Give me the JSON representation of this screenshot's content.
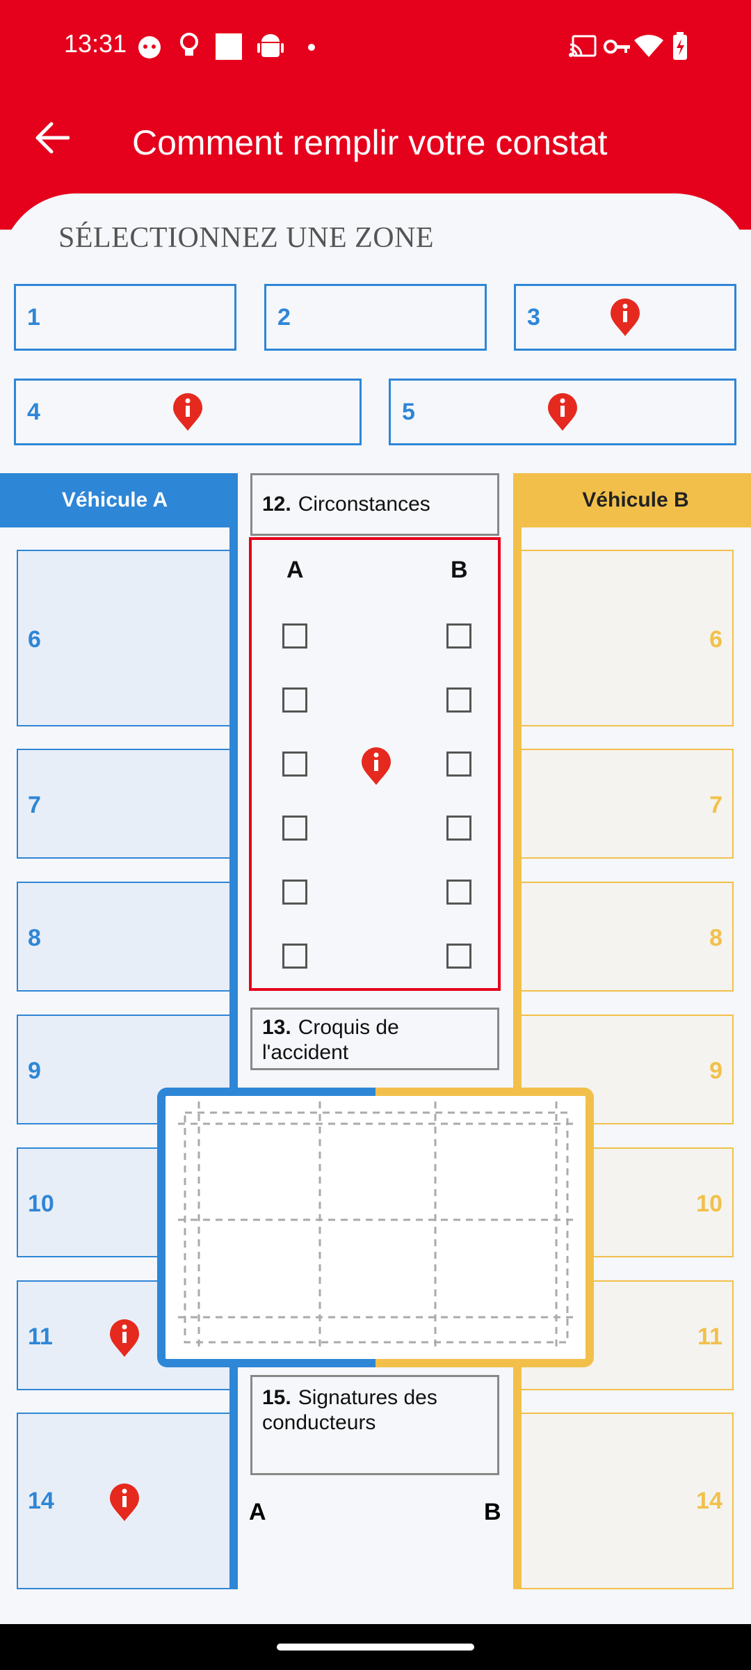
{
  "status_bar": {
    "time": "13:31"
  },
  "header": {
    "title": "Comment remplir votre constat"
  },
  "zone_section": {
    "heading": "SÉLECTIONNEZ UNE ZONE"
  },
  "zones": [
    {
      "label": "1"
    },
    {
      "label": "2"
    },
    {
      "label": "3"
    },
    {
      "label": "4"
    },
    {
      "label": "5"
    }
  ],
  "vehicle_a": {
    "title": "Véhicule A",
    "boxes": [
      "6",
      "7",
      "8",
      "9",
      "10",
      "11",
      "14"
    ]
  },
  "vehicle_b": {
    "title": "Véhicule B",
    "boxes": [
      "6",
      "7",
      "8",
      "9",
      "10",
      "11",
      "14"
    ]
  },
  "circumstances": {
    "number": "12.",
    "title": "Circonstances",
    "col_a": "A",
    "col_b": "B"
  },
  "sketch": {
    "number": "13.",
    "title": "Croquis de l'accident"
  },
  "signatures": {
    "number": "15.",
    "title": "Signatures des conducteurs",
    "a": "A",
    "b": "B"
  },
  "colors": {
    "header": "#e5001c",
    "vehicle_a": "#2e86d6",
    "vehicle_b": "#f2c04a",
    "pin": "#e5291e"
  }
}
